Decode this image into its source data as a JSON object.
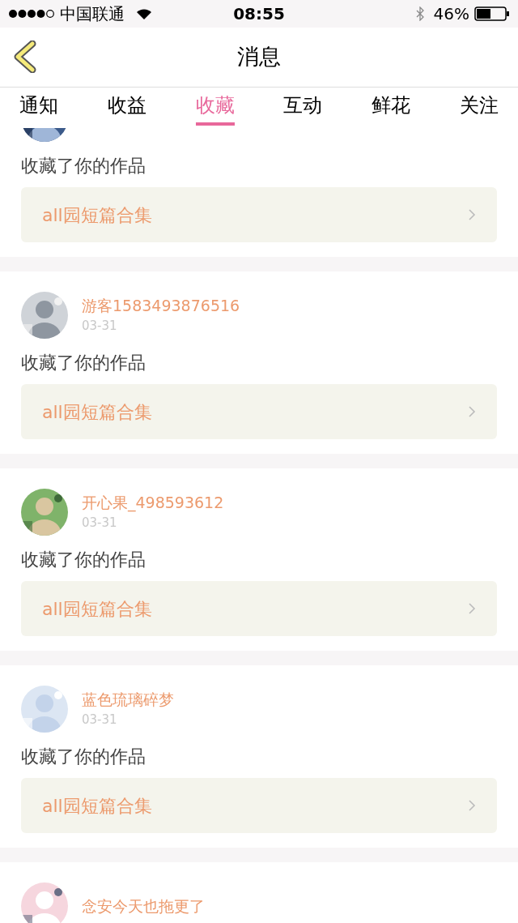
{
  "status_bar": {
    "carrier": "中国联通",
    "time": "08:55",
    "battery": "46%"
  },
  "nav": {
    "title": "消息"
  },
  "tabs": [
    {
      "label": "通知",
      "selected": false
    },
    {
      "label": "收益",
      "selected": false
    },
    {
      "label": "收藏",
      "selected": true
    },
    {
      "label": "互动",
      "selected": false
    },
    {
      "label": "鲜花",
      "selected": false
    },
    {
      "label": "关注",
      "selected": false
    }
  ],
  "items": [
    {
      "action": "收藏了你的作品",
      "work": "all园短篇合集"
    },
    {
      "name": "游客1583493876516",
      "date": "03-31",
      "action": "收藏了你的作品",
      "work": "all园短篇合集"
    },
    {
      "name": "开心果_498593612",
      "date": "03-31",
      "action": "收藏了你的作品",
      "work": "all园短篇合集"
    },
    {
      "name": "蓝色琉璃碎梦",
      "date": "03-31",
      "action": "收藏了你的作品",
      "work": "all园短篇合集"
    },
    {
      "name": "念安今天也拖更了"
    }
  ]
}
